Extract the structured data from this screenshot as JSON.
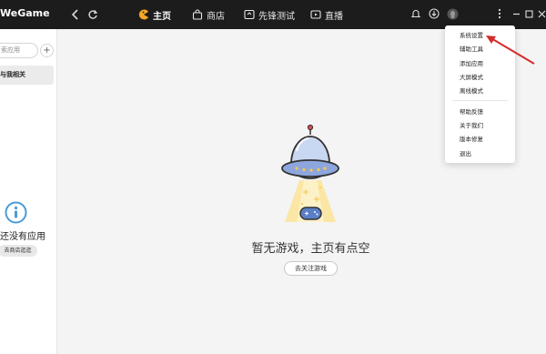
{
  "app": {
    "title": "WeGame"
  },
  "nav": {
    "back_icon": "chevron-left-icon",
    "refresh_icon": "refresh-icon",
    "tabs": [
      {
        "label": "主页",
        "icon": "pacman-icon",
        "active": true
      },
      {
        "label": "商店",
        "icon": "bag-icon",
        "active": false
      },
      {
        "label": "先锋测试",
        "icon": "test-icon",
        "active": false
      },
      {
        "label": "直播",
        "icon": "play-icon",
        "active": false
      }
    ]
  },
  "sidebar": {
    "search_placeholder": "索应用",
    "add_label": "+",
    "items": [
      {
        "label": "与我相关"
      }
    ],
    "empty_text": "还没有应用",
    "store_button": "去商店逛逛"
  },
  "main": {
    "empty_title": "暂无游戏，主页有点空",
    "follow_button": "去关注游戏"
  },
  "menu": {
    "items": [
      "系统设置",
      "辅助工具",
      "添加应用",
      "大屏模式",
      "离线模式",
      "帮助反馈",
      "关于我们",
      "版本修复",
      "退出"
    ]
  },
  "colors": {
    "titlebar": "#1c1c1c",
    "accent": "#4a9bd6",
    "arrow": "#d62b2b",
    "ufo_beam": "#fbe6a6"
  }
}
